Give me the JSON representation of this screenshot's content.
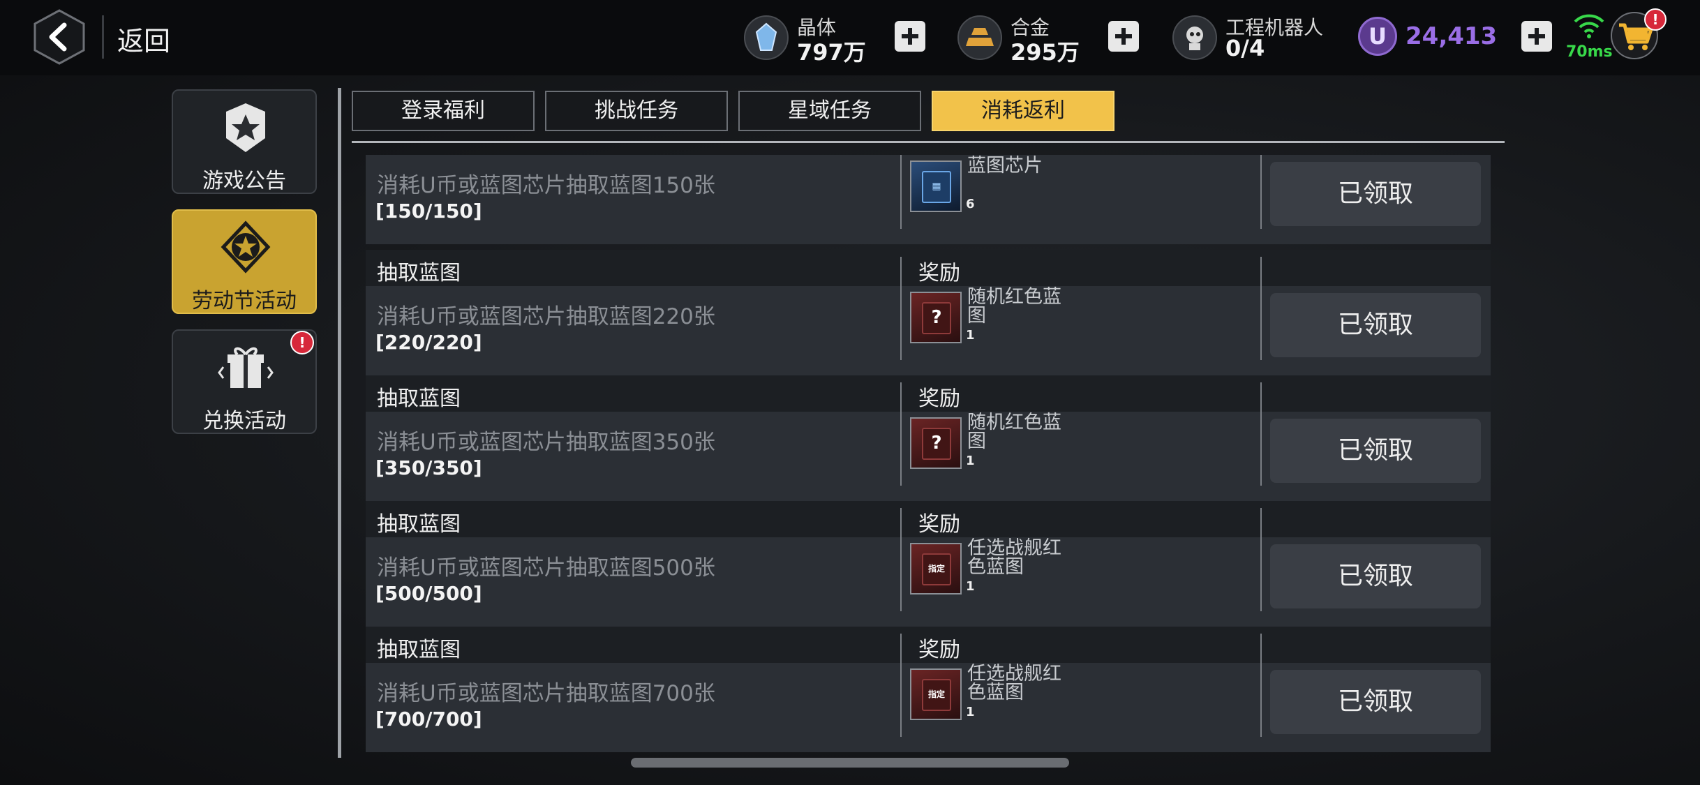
{
  "header": {
    "back_label": "返回",
    "resources": [
      {
        "name": "晶体",
        "value": "797万",
        "icon": "crystal-icon"
      },
      {
        "name": "合金",
        "value": "295万",
        "icon": "alloy-icon"
      },
      {
        "name": "工程机器人",
        "value": "0/4",
        "icon": "robot-icon"
      }
    ],
    "u_coin": {
      "symbol": "U",
      "value": "24,413"
    },
    "ping": "70ms",
    "cart_badge": "!"
  },
  "sidebar": {
    "items": [
      {
        "label": "游戏公告",
        "active": false
      },
      {
        "label": "劳动节活动",
        "active": true
      },
      {
        "label": "兑换活动",
        "active": false,
        "badge": "!"
      }
    ]
  },
  "tabs": [
    {
      "label": "登录福利",
      "active": false
    },
    {
      "label": "挑战任务",
      "active": false
    },
    {
      "label": "星域任务",
      "active": false
    },
    {
      "label": "消耗返利",
      "active": true
    }
  ],
  "tasks": [
    {
      "title": "",
      "reward_header": "",
      "desc": "消耗U币或蓝图芯片抽取蓝图150张",
      "progress": "[150/150]",
      "reward_name": "蓝图芯片",
      "reward_qty": "6",
      "reward_kind": "chip",
      "button": "已领取"
    },
    {
      "title": "抽取蓝图",
      "reward_header": "奖励",
      "desc": "消耗U币或蓝图芯片抽取蓝图220张",
      "progress": "[220/220]",
      "reward_name": "随机红色蓝图",
      "reward_qty": "1",
      "reward_kind": "random",
      "button": "已领取"
    },
    {
      "title": "抽取蓝图",
      "reward_header": "奖励",
      "desc": "消耗U币或蓝图芯片抽取蓝图350张",
      "progress": "[350/350]",
      "reward_name": "随机红色蓝图",
      "reward_qty": "1",
      "reward_kind": "random",
      "button": "已领取"
    },
    {
      "title": "抽取蓝图",
      "reward_header": "奖励",
      "desc": "消耗U币或蓝图芯片抽取蓝图500张",
      "progress": "[500/500]",
      "reward_name": "任选战舰红色蓝图",
      "reward_qty": "1",
      "reward_kind": "select",
      "button": "已领取"
    },
    {
      "title": "抽取蓝图",
      "reward_header": "奖励",
      "desc": "消耗U币或蓝图芯片抽取蓝图700张",
      "progress": "[700/700]",
      "reward_name": "任选战舰红色蓝图",
      "reward_qty": "1",
      "reward_kind": "select",
      "button": "已领取"
    }
  ],
  "reward_glyphs": {
    "random": "?",
    "select": "指定",
    "chip": "▦"
  },
  "colors": {
    "accent": "#f2c24a",
    "active_side": "#c9a330",
    "u_coin": "#9a6ee6",
    "ping": "#38d94a",
    "badge": "#d7283a"
  }
}
